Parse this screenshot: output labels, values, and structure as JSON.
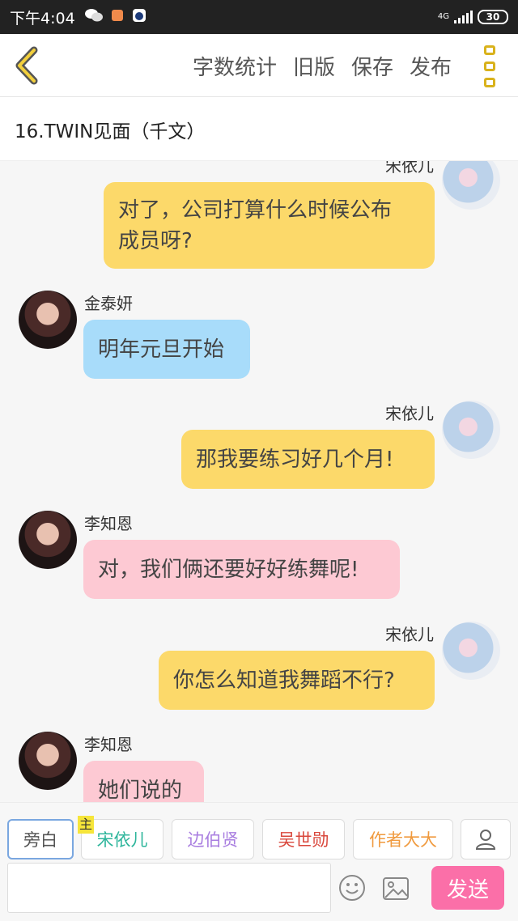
{
  "status_bar": {
    "time": "下午4:04",
    "network": "4G",
    "battery": "30"
  },
  "toolbar": {
    "actions": [
      "字数统计",
      "旧版",
      "保存",
      "发布"
    ]
  },
  "chapter_title": "16.TWIN见面（千文）",
  "messages": [
    {
      "speaker": "宋依儿",
      "text_line1": "对了，公司打算什么时候公布",
      "text_line2": "成员呀?"
    },
    {
      "speaker": "金泰妍",
      "text": "明年元旦开始"
    },
    {
      "speaker": "宋依儿",
      "text": "那我要练习好几个月!"
    },
    {
      "speaker": "李知恩",
      "text": "对，我们俩还要好好练舞呢!"
    },
    {
      "speaker": "宋依儿",
      "text": "你怎么知道我舞蹈不行?"
    },
    {
      "speaker": "李知恩",
      "text": "她们说的"
    }
  ],
  "roles": {
    "narration": "旁白",
    "host_tag": "主",
    "role1": "宋依儿",
    "role2": "边伯贤",
    "role3": "吴世勋",
    "role4": "作者大大"
  },
  "role_colors": {
    "role1": "#2db59b",
    "role2": "#a97ee0",
    "role3": "#d9473c",
    "role4": "#f09a3e"
  },
  "input": {
    "placeholder": "",
    "send_label": "发送"
  }
}
